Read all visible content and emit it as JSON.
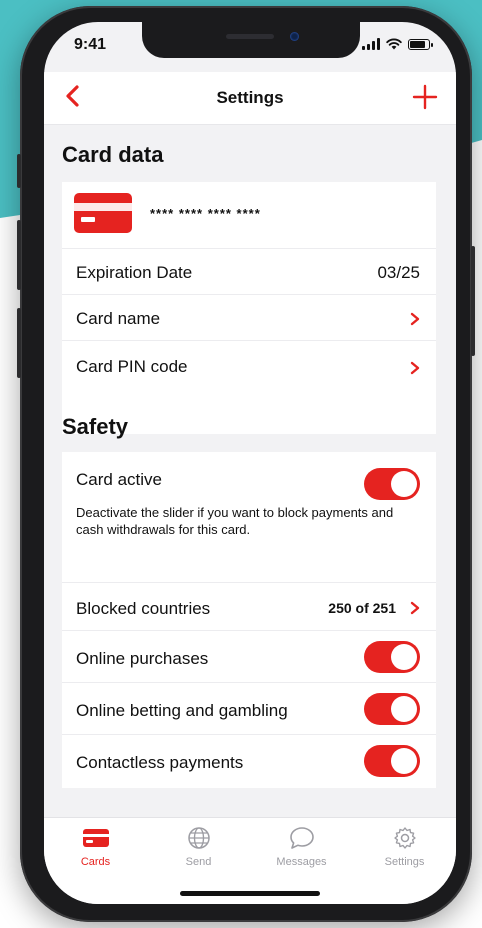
{
  "status": {
    "time": "9:41"
  },
  "nav": {
    "title": "Settings"
  },
  "card_data": {
    "title": "Card data",
    "masked_number": "**** **** **** ****",
    "expiration_label": "Expiration Date",
    "expiration_value": "03/25",
    "card_name_label": "Card name",
    "pin_label": "Card PIN code"
  },
  "safety": {
    "title": "Safety",
    "card_active_label": "Card active",
    "card_active_on": true,
    "card_active_note": "Deactivate the slider if you want to block payments and cash withdrawals for this card.",
    "blocked_countries_label": "Blocked countries",
    "blocked_countries_value": "250 of 251",
    "online_purchases_label": "Online purchases",
    "online_purchases_on": true,
    "betting_label": "Online betting and gambling",
    "betting_on": true,
    "contactless_label": "Contactless payments",
    "contactless_on": true
  },
  "tabs": [
    {
      "label": "Cards",
      "icon": "card-icon",
      "active": true
    },
    {
      "label": "Send",
      "icon": "globe-icon",
      "active": false
    },
    {
      "label": "Messages",
      "icon": "chat-bubble-icon",
      "active": false
    },
    {
      "label": "Settings",
      "icon": "gear-icon",
      "active": false
    }
  ],
  "colors": {
    "accent": "#e52320",
    "background_teal": "#4bbfc3",
    "screen_bg": "#f2f2f4"
  }
}
